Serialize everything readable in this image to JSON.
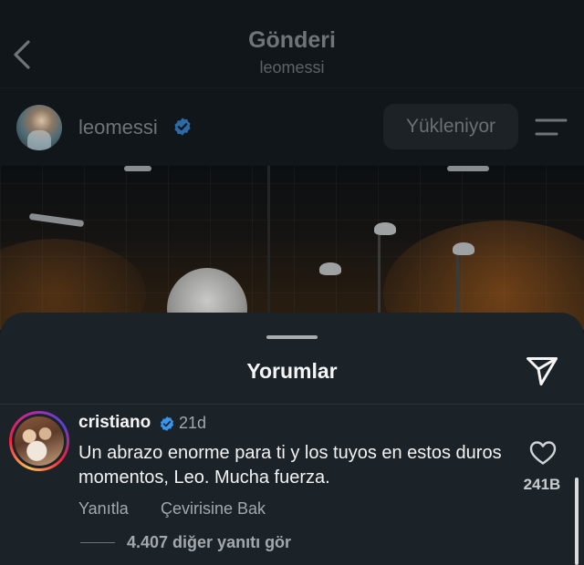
{
  "header": {
    "title": "Gönderi",
    "subtitle": "leomessi"
  },
  "post": {
    "username": "leomessi",
    "verified": true,
    "status_button": "Yükleniyor"
  },
  "comments_sheet": {
    "title": "Yorumlar",
    "comments": [
      {
        "username": "cristiano",
        "verified": true,
        "time": "21d",
        "text": "Un abrazo enorme para ti y los tuyos en estos duros momentos, Leo. Mucha fuerza.",
        "reply_label": "Yanıtla",
        "translate_label": "Çevirisine Bak",
        "like_count": "241B",
        "more_replies": "4.407 diğer yanıtı gör"
      }
    ]
  },
  "colors": {
    "verified_badge": "#3797f0",
    "sheet_background": "#1c2328"
  },
  "icons": [
    "back-icon",
    "verified-icon",
    "menu-icon",
    "share-icon",
    "heart-icon"
  ]
}
